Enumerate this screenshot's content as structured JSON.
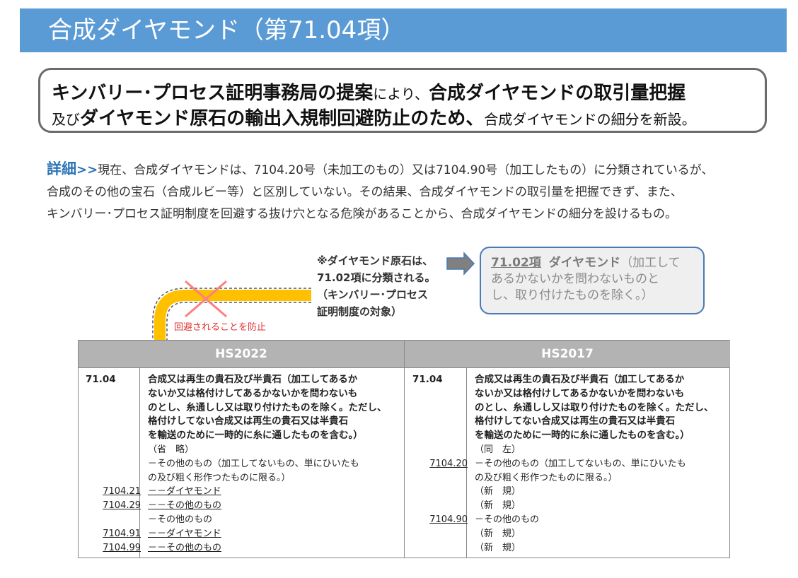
{
  "title": "合成ダイヤモンド（第71.04項）",
  "summary": {
    "line1_bold_a": "キンバリー･プロセス証明事務局の提案",
    "line1_small": "により、",
    "line1_bold_b": "合成ダイヤモンドの取引量把握",
    "line2_small_a": "及び",
    "line2_bold": "ダイヤモンド原石の輸出入規制回避防止のため、",
    "line2_small_b": "合成ダイヤモンドの細分を新設。"
  },
  "detail": {
    "label": "詳細",
    "arrows": ">>",
    "line1": "現在、合成ダイヤモンドは、7104.20号（未加工のもの）又は7104.90号（加工したもの）に分類されているが、",
    "line2": "合成のその他の宝石（合成ルビー等）と区別していない。その結果、合成ダイヤモンドの取引量を把握できず、また、",
    "line3": "キンバリー･プロセス証明制度を回避する抜け穴となる危険があることから、合成ダイヤモンドの細分を設けるもの。"
  },
  "note": {
    "line1": "※ダイヤモンド原石は、",
    "line2": "71.02項に分類される。",
    "line3": "（キンバリー･プロセス",
    "line4": "証明制度の対象）"
  },
  "reference": {
    "code": "71.02項",
    "name": "ダイヤモンド",
    "line1_rest": "（加工して",
    "line2": "あるかないかを問わないものと",
    "line3": "し、取り付けたものを除く。）"
  },
  "prevent_label": "回避されることを防止",
  "table": {
    "header_left": "HS2022",
    "header_right": "HS2017",
    "heading_code": "71.04",
    "heading_desc": [
      "合成又は再生の貴石及び半貴石（加工してあるか",
      "ないか又は格付けしてあるかないかを問わないも",
      "のとし、糸通しし又は取り付けたものを除く。ただし、",
      "格付けしてない合成又は再生の貴石又は半貴石",
      "を輸送のために一時的に糸に通したものを含む。）"
    ],
    "left_rows": [
      {
        "code": "",
        "text": "（省　略）"
      },
      {
        "code": "",
        "text": "－その他のもの（加工してないもの、単にひいたも"
      },
      {
        "code": "",
        "text": "の及び粗く形作つたものに限る。）"
      },
      {
        "code": "7104.21",
        "text": "－－ダイヤモンド"
      },
      {
        "code": "7104.29",
        "text": "－－その他のもの"
      },
      {
        "code": "",
        "text": "－その他のもの"
      },
      {
        "code": "7104.91",
        "text": "－－ダイヤモンド"
      },
      {
        "code": "7104.99",
        "text": "－－その他のもの"
      }
    ],
    "right_rows": [
      {
        "code": "",
        "text": "（同　左）"
      },
      {
        "code": "7104.20",
        "text": "－その他のもの（加工してないもの、単にひいたも"
      },
      {
        "code": "",
        "text": "の及び粗く形作つたものに限る。）"
      },
      {
        "code": "",
        "text": "（新　規）"
      },
      {
        "code": "",
        "text": "（新　規）"
      },
      {
        "code": "7104.90",
        "text": "－その他のもの"
      },
      {
        "code": "",
        "text": "（新　規）"
      },
      {
        "code": "",
        "text": "（新　規）"
      }
    ]
  },
  "colors": {
    "title_bar": "#5b9bd5",
    "accent_blue": "#2e75b6",
    "arrow_yellow": "#ffc000",
    "cross_red": "#ff7f7f",
    "header_gray": "#b3b3b3"
  }
}
